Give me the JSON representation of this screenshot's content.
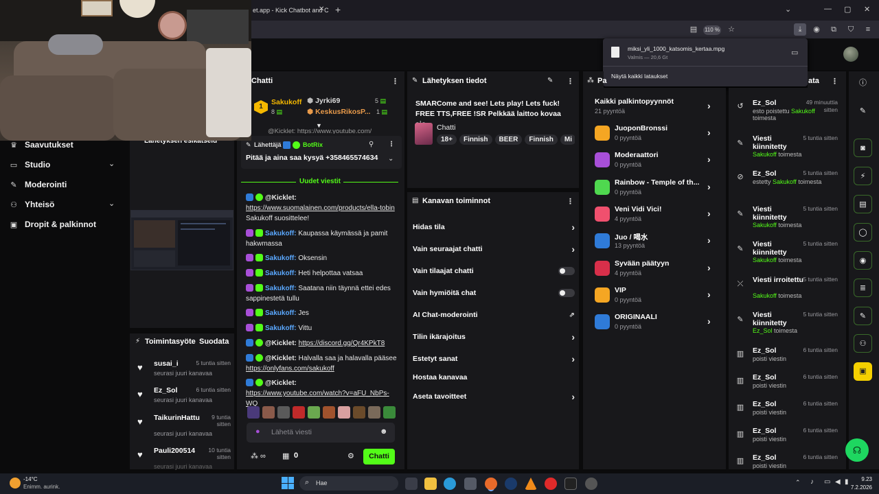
{
  "browser": {
    "tab_title": "et.app - Kick Chatbot and C",
    "zoom": "110 %",
    "download": {
      "filename": "miksi_yli_1000_katsomis_kertaa.mpg",
      "status": "Valmis — 20,6 Gt",
      "show_all": "Näytä kaikki lataukset"
    }
  },
  "nav": {
    "items": [
      {
        "label": "Saavutukset",
        "icon": "trophy-icon"
      },
      {
        "label": "Studio",
        "icon": "studio-icon"
      },
      {
        "label": "Moderointi",
        "icon": "wrench-icon"
      },
      {
        "label": "Yhteisö",
        "icon": "community-icon"
      },
      {
        "label": "Dropit & palkinnot",
        "icon": "gift-icon"
      }
    ]
  },
  "preview": {
    "title": "Lähetyksen esikatselu"
  },
  "activity": {
    "title": "Toimintasyöte",
    "filter": "Suodata",
    "items": [
      {
        "name": "susai_i",
        "time": "5 tuntia sitten",
        "action": "seurasi juuri kanavaa"
      },
      {
        "name": "Ez_Sol",
        "time": "6 tuntia sitten",
        "action": "seurasi juuri kanavaa"
      },
      {
        "name": "TaikurinHattu",
        "time": "9 tuntia sitten",
        "action": "seurasi juuri kanavaa"
      },
      {
        "name": "Pauli200514",
        "time": "10 tuntia sitten",
        "action": "seurasi juuri kanavaa"
      }
    ]
  },
  "chat": {
    "title": "Chatti",
    "leaderboard": [
      {
        "rank": "1",
        "name": "Sakukoff",
        "count": "8"
      },
      {
        "name": "Jyrki69",
        "count": "5"
      },
      {
        "name": "KeskusRikosP...",
        "count": "1"
      }
    ],
    "cut_line": "@Kicklet: https://www.youtube.com/",
    "pinned": {
      "label": "Lähettäjä",
      "user": "BotRix",
      "text": "Pitää ja aina saa kysyä +358465574634"
    },
    "new_messages": "Uudet viestit",
    "messages": [
      {
        "user": "@Kicklet:",
        "text": "https://www.suomalainen.com/products/ella-tobin",
        "extra": "Sakukoff suosittelee!"
      },
      {
        "user": "Sakukoff:",
        "text": "Kaupassa käymässä ja pamit hakwmassa"
      },
      {
        "user": "Sakukoff:",
        "text": "Oksensin"
      },
      {
        "user": "Sakukoff:",
        "text": "Heti helpottaa vatsaa"
      },
      {
        "user": "Sakukoff:",
        "text": "Saatana niin täynnä ettei edes sappinestetä tullu"
      },
      {
        "user": "Sakukoff:",
        "text": "Jes"
      },
      {
        "user": "Sakukoff:",
        "text": "Vittu"
      },
      {
        "user": "@Kicklet:",
        "text": "https://discord.gg/Qr4KPkT8"
      },
      {
        "user": "@Kicklet:",
        "text": "Halvalla saa ja halavalla pääsee",
        "link": "https://onlyfans.com/sakukoff"
      },
      {
        "user": "@Kicklet:",
        "text": "https://www.youtube.com/watch?v=aFU_NbPs-WQ"
      }
    ],
    "input_placeholder": "Lähetä viesti",
    "points": "0",
    "send": "Chatti"
  },
  "stream_info": {
    "title": "Lähetyksen tiedot",
    "stream_title": "SMARCome and see! Lets play! Lets fuck! FREE TTS,FREE !SR Pelkkää laittoo kovaa ajo...",
    "category": "Chatti",
    "tags": [
      "18+",
      "Finnish",
      "BEER",
      "Finnish",
      "Mi"
    ]
  },
  "channel_actions": {
    "title": "Kanavan toiminnot",
    "items": [
      {
        "label": "Hidas tila",
        "control": "chevron"
      },
      {
        "label": "Vain seuraajat chatti",
        "control": "chevron"
      },
      {
        "label": "Vain tilaajat chatti",
        "control": "toggle"
      },
      {
        "label": "Vain hymiöitä chat",
        "control": "toggle"
      },
      {
        "label": "AI Chat-moderointi",
        "control": "external"
      },
      {
        "label": "Tilin ikärajoitus",
        "control": "chevron"
      },
      {
        "label": "Estetyt sanat",
        "control": "chevron"
      },
      {
        "label": "Hostaa kanavaa",
        "control": "none"
      },
      {
        "label": "Aseta tavoitteet",
        "control": "chevron"
      }
    ]
  },
  "rewards": {
    "title": "Pa",
    "all": {
      "label": "Kaikki palkintopyynnöt",
      "count": "21 pyyntöä"
    },
    "items": [
      {
        "name": "JuoponBronssi",
        "count": "0 pyyntöä",
        "color": "#f5a623"
      },
      {
        "name": "Moderaattori",
        "count": "0 pyyntöä",
        "color": "#a84fd8"
      },
      {
        "name": "Rainbow - Temple of th...",
        "count": "0 pyyntöä",
        "color": "#4fd84f"
      },
      {
        "name": "Veni Vidi Vici!",
        "count": "4 pyyntöä",
        "color": "#f0506e"
      },
      {
        "name": "Juo / 喝水",
        "count": "13 pyyntöä",
        "color": "#2f7bd8"
      },
      {
        "name": "Syvään päätyyn",
        "count": "4 pyyntöä",
        "color": "#d82f4a"
      },
      {
        "name": "VIP",
        "count": "0 pyyntöä",
        "color": "#f5a623"
      },
      {
        "name": "ORIGINAALI",
        "count": "0 pyyntöä",
        "color": "#2f7bd8"
      }
    ]
  },
  "mod_log": {
    "title": "ata",
    "items": [
      {
        "icon": "undo-icon",
        "title": "Ez_Sol",
        "time": "49 minuuttia sitten",
        "sub1": "esto poistettu ",
        "user": "Sakukoff",
        "sub2": "toimesta"
      },
      {
        "icon": "pin-icon",
        "title": "Viesti kiinnitetty",
        "time": "5 tuntia sitten",
        "user": "Sakukoff",
        "sub2": "toimesta"
      },
      {
        "icon": "ban-icon",
        "title": "Ez_Sol",
        "time": "5 tuntia sitten",
        "sub1": "estetty ",
        "user": "Sakukoff",
        "sub2": "toimesta"
      },
      {
        "icon": "pin-icon",
        "title": "Viesti kiinnitetty",
        "time": "5 tuntia sitten",
        "user": "Sakukoff",
        "sub2": "toimesta"
      },
      {
        "icon": "pin-icon",
        "title": "Viesti kiinnitetty",
        "time": "5 tuntia sitten",
        "user": "Sakukoff",
        "sub2": "toimesta"
      },
      {
        "icon": "unpin-icon",
        "title": "Viesti irroitettu",
        "time": "5 tuntia sitten",
        "user": "Sakukoff",
        "sub2": "toimesta"
      },
      {
        "icon": "pin-icon",
        "title": "Viesti kiinnitetty",
        "time": "5 tuntia sitten",
        "user": "Ez_Sol",
        "sub2": "toimesta"
      },
      {
        "icon": "trash-icon",
        "title": "Ez_Sol",
        "time": "6 tuntia sitten",
        "sub1": "poisti viestin"
      },
      {
        "icon": "trash-icon",
        "title": "Ez_Sol",
        "time": "6 tuntia sitten",
        "sub1": "poisti viestin"
      },
      {
        "icon": "trash-icon",
        "title": "Ez_Sol",
        "time": "6 tuntia sitten",
        "sub1": "poisti viestin"
      },
      {
        "icon": "trash-icon",
        "title": "Ez_Sol",
        "time": "6 tuntia sitten",
        "sub1": "poisti viestin"
      },
      {
        "icon": "trash-icon",
        "title": "Ez_Sol",
        "time": "6 tuntia sitten",
        "sub1": "poisti viestin"
      }
    ]
  },
  "taskbar": {
    "weather_temp": "-14°C",
    "weather_desc": "Enimm. aurink.",
    "search": "Hae",
    "time": "9.23",
    "date": "7.2.2026"
  },
  "colors": {
    "accent": "#53fc18",
    "panel": "#18181b",
    "bg": "#0b0b0c"
  }
}
